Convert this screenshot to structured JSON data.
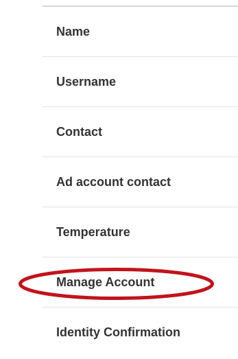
{
  "menu": {
    "items": [
      {
        "label": "Name"
      },
      {
        "label": "Username"
      },
      {
        "label": "Contact"
      },
      {
        "label": "Ad account contact"
      },
      {
        "label": "Temperature"
      },
      {
        "label": "Manage Account",
        "highlighted": true
      },
      {
        "label": "Identity Confirmation"
      }
    ]
  },
  "annotation": {
    "color": "#c0141c"
  }
}
